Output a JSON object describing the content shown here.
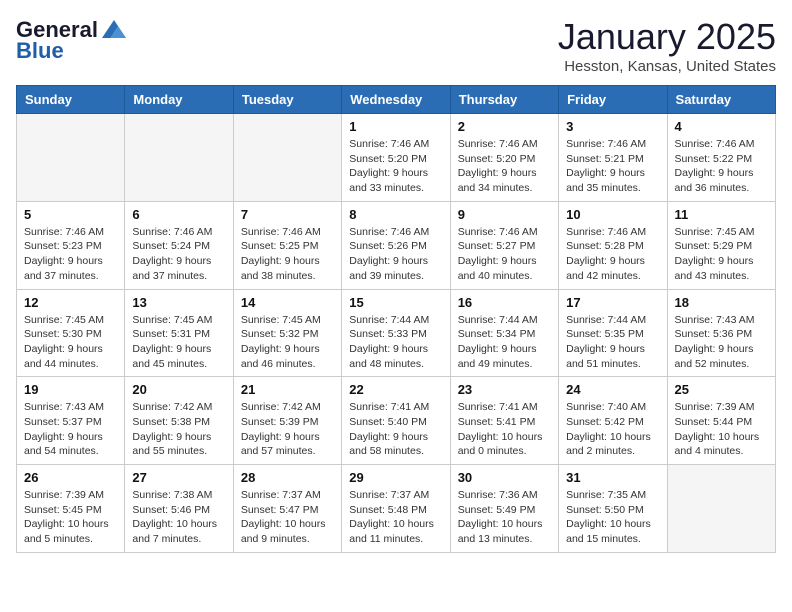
{
  "header": {
    "logo_general": "General",
    "logo_blue": "Blue",
    "month_title": "January 2025",
    "location": "Hesston, Kansas, United States"
  },
  "weekdays": [
    "Sunday",
    "Monday",
    "Tuesday",
    "Wednesday",
    "Thursday",
    "Friday",
    "Saturday"
  ],
  "weeks": [
    [
      {
        "day": "",
        "info": ""
      },
      {
        "day": "",
        "info": ""
      },
      {
        "day": "",
        "info": ""
      },
      {
        "day": "1",
        "info": "Sunrise: 7:46 AM\nSunset: 5:20 PM\nDaylight: 9 hours and 33 minutes."
      },
      {
        "day": "2",
        "info": "Sunrise: 7:46 AM\nSunset: 5:20 PM\nDaylight: 9 hours and 34 minutes."
      },
      {
        "day": "3",
        "info": "Sunrise: 7:46 AM\nSunset: 5:21 PM\nDaylight: 9 hours and 35 minutes."
      },
      {
        "day": "4",
        "info": "Sunrise: 7:46 AM\nSunset: 5:22 PM\nDaylight: 9 hours and 36 minutes."
      }
    ],
    [
      {
        "day": "5",
        "info": "Sunrise: 7:46 AM\nSunset: 5:23 PM\nDaylight: 9 hours and 37 minutes."
      },
      {
        "day": "6",
        "info": "Sunrise: 7:46 AM\nSunset: 5:24 PM\nDaylight: 9 hours and 37 minutes."
      },
      {
        "day": "7",
        "info": "Sunrise: 7:46 AM\nSunset: 5:25 PM\nDaylight: 9 hours and 38 minutes."
      },
      {
        "day": "8",
        "info": "Sunrise: 7:46 AM\nSunset: 5:26 PM\nDaylight: 9 hours and 39 minutes."
      },
      {
        "day": "9",
        "info": "Sunrise: 7:46 AM\nSunset: 5:27 PM\nDaylight: 9 hours and 40 minutes."
      },
      {
        "day": "10",
        "info": "Sunrise: 7:46 AM\nSunset: 5:28 PM\nDaylight: 9 hours and 42 minutes."
      },
      {
        "day": "11",
        "info": "Sunrise: 7:45 AM\nSunset: 5:29 PM\nDaylight: 9 hours and 43 minutes."
      }
    ],
    [
      {
        "day": "12",
        "info": "Sunrise: 7:45 AM\nSunset: 5:30 PM\nDaylight: 9 hours and 44 minutes."
      },
      {
        "day": "13",
        "info": "Sunrise: 7:45 AM\nSunset: 5:31 PM\nDaylight: 9 hours and 45 minutes."
      },
      {
        "day": "14",
        "info": "Sunrise: 7:45 AM\nSunset: 5:32 PM\nDaylight: 9 hours and 46 minutes."
      },
      {
        "day": "15",
        "info": "Sunrise: 7:44 AM\nSunset: 5:33 PM\nDaylight: 9 hours and 48 minutes."
      },
      {
        "day": "16",
        "info": "Sunrise: 7:44 AM\nSunset: 5:34 PM\nDaylight: 9 hours and 49 minutes."
      },
      {
        "day": "17",
        "info": "Sunrise: 7:44 AM\nSunset: 5:35 PM\nDaylight: 9 hours and 51 minutes."
      },
      {
        "day": "18",
        "info": "Sunrise: 7:43 AM\nSunset: 5:36 PM\nDaylight: 9 hours and 52 minutes."
      }
    ],
    [
      {
        "day": "19",
        "info": "Sunrise: 7:43 AM\nSunset: 5:37 PM\nDaylight: 9 hours and 54 minutes."
      },
      {
        "day": "20",
        "info": "Sunrise: 7:42 AM\nSunset: 5:38 PM\nDaylight: 9 hours and 55 minutes."
      },
      {
        "day": "21",
        "info": "Sunrise: 7:42 AM\nSunset: 5:39 PM\nDaylight: 9 hours and 57 minutes."
      },
      {
        "day": "22",
        "info": "Sunrise: 7:41 AM\nSunset: 5:40 PM\nDaylight: 9 hours and 58 minutes."
      },
      {
        "day": "23",
        "info": "Sunrise: 7:41 AM\nSunset: 5:41 PM\nDaylight: 10 hours and 0 minutes."
      },
      {
        "day": "24",
        "info": "Sunrise: 7:40 AM\nSunset: 5:42 PM\nDaylight: 10 hours and 2 minutes."
      },
      {
        "day": "25",
        "info": "Sunrise: 7:39 AM\nSunset: 5:44 PM\nDaylight: 10 hours and 4 minutes."
      }
    ],
    [
      {
        "day": "26",
        "info": "Sunrise: 7:39 AM\nSunset: 5:45 PM\nDaylight: 10 hours and 5 minutes."
      },
      {
        "day": "27",
        "info": "Sunrise: 7:38 AM\nSunset: 5:46 PM\nDaylight: 10 hours and 7 minutes."
      },
      {
        "day": "28",
        "info": "Sunrise: 7:37 AM\nSunset: 5:47 PM\nDaylight: 10 hours and 9 minutes."
      },
      {
        "day": "29",
        "info": "Sunrise: 7:37 AM\nSunset: 5:48 PM\nDaylight: 10 hours and 11 minutes."
      },
      {
        "day": "30",
        "info": "Sunrise: 7:36 AM\nSunset: 5:49 PM\nDaylight: 10 hours and 13 minutes."
      },
      {
        "day": "31",
        "info": "Sunrise: 7:35 AM\nSunset: 5:50 PM\nDaylight: 10 hours and 15 minutes."
      },
      {
        "day": "",
        "info": ""
      }
    ]
  ]
}
